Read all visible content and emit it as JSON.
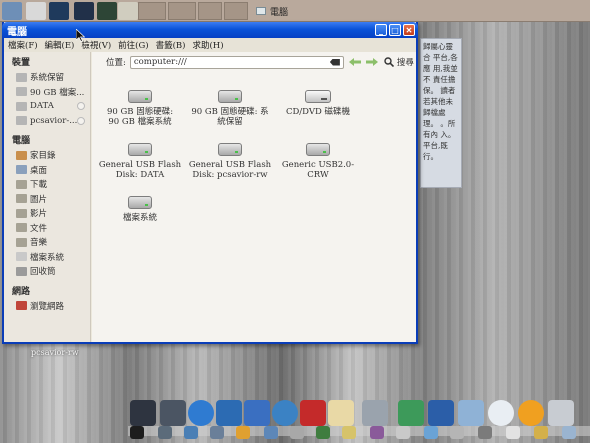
{
  "top_panel": {
    "task_label": "電腦"
  },
  "window": {
    "title": "電腦",
    "menu": [
      "檔案(F)",
      "編輯(E)",
      "檢視(V)",
      "前往(G)",
      "書籤(B)",
      "求助(H)"
    ],
    "location_label": "位置:",
    "location_value": "computer:///",
    "search_label": "搜尋"
  },
  "sidebar": {
    "devices_heading": "裝置",
    "devices": [
      "系統保留",
      "90 GB 檔案...",
      "DATA",
      "pcsavior-..."
    ],
    "computer_heading": "電腦",
    "places": [
      "家目錄",
      "桌面",
      "下載",
      "圖片",
      "影片",
      "文件",
      "音樂",
      "檔案系統",
      "回收筒"
    ],
    "network_heading": "網路",
    "network": [
      "瀏覽網路"
    ]
  },
  "items": [
    {
      "line1": "90 GB 固態硬碟:",
      "line2": "90 GB 檔案系統",
      "kind": "drive"
    },
    {
      "line1": "90 GB 固態硬碟: 系",
      "line2": "統保留",
      "kind": "drive"
    },
    {
      "line1": "CD/DVD 磁碟機",
      "line2": "",
      "kind": "cd"
    },
    {
      "line1": "General USB Flash",
      "line2": "Disk: DATA",
      "kind": "drive"
    },
    {
      "line1": "General USB Flash",
      "line2": "Disk: pcsavior-rw",
      "kind": "drive"
    },
    {
      "line1": "Generic USB2.0-",
      "line2": "CRW",
      "kind": "drive"
    },
    {
      "line1": "檔案系統",
      "line2": "",
      "kind": "drive"
    }
  ],
  "desktop_label": "pcsavior-rw",
  "note_text": "歸屬心靈合 平台,各應 用,我並不 責任擔保。 讀者若其他未 歸檔處理。 。所有內 入。 平台,既 行。"
}
